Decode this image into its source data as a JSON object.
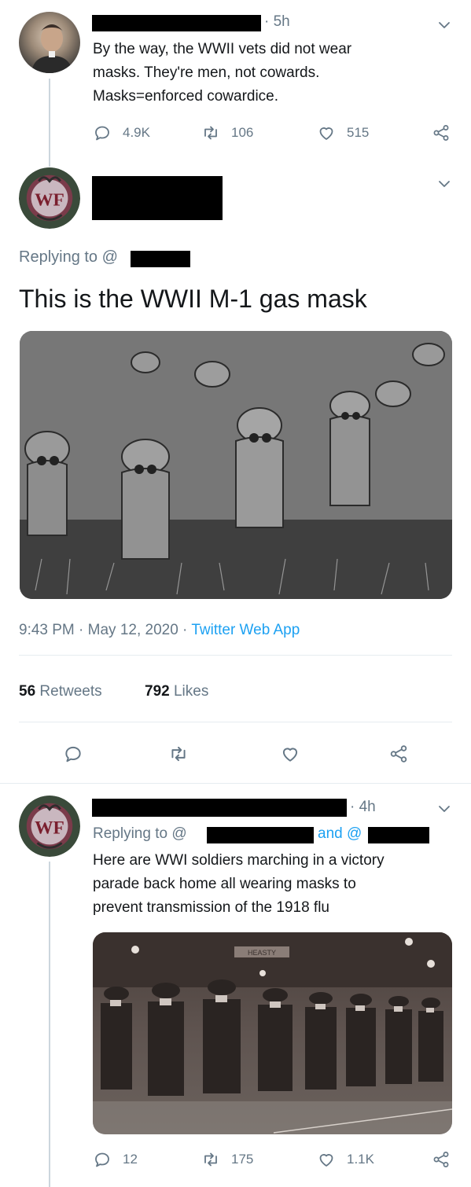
{
  "tweet1": {
    "time": "5h",
    "text_lines": [
      "By the way, the WWII vets did not wear",
      "masks. They're men, not cowards.",
      "Masks=enforced cowardice."
    ],
    "replies": "4.9K",
    "retweets": "106",
    "likes": "515"
  },
  "tweet2": {
    "replying_prefix": "Replying to @",
    "text": "This is the WWII M-1 gas mask",
    "timestamp": "9:43 PM · May 12, 2020 · ",
    "source": "Twitter Web App",
    "retweet_count": "56",
    "retweet_label": " Retweets",
    "like_count": "792",
    "like_label": " Likes"
  },
  "tweet3": {
    "time": "4h",
    "replying_prefix": "Replying to @",
    "and_label": "and @",
    "text_lines": [
      "Here are WWI soldiers marching in a victory",
      "parade back home all wearing masks to",
      "prevent transmission of the 1918 flu"
    ],
    "photo_sign": "HEASTY",
    "replies": "12",
    "retweets": "175",
    "likes": "1.1K"
  },
  "avatar_badge_text": "WF",
  "colors": {
    "link": "#1da1f2",
    "muted": "#657786",
    "divider": "#e6ecf0"
  }
}
